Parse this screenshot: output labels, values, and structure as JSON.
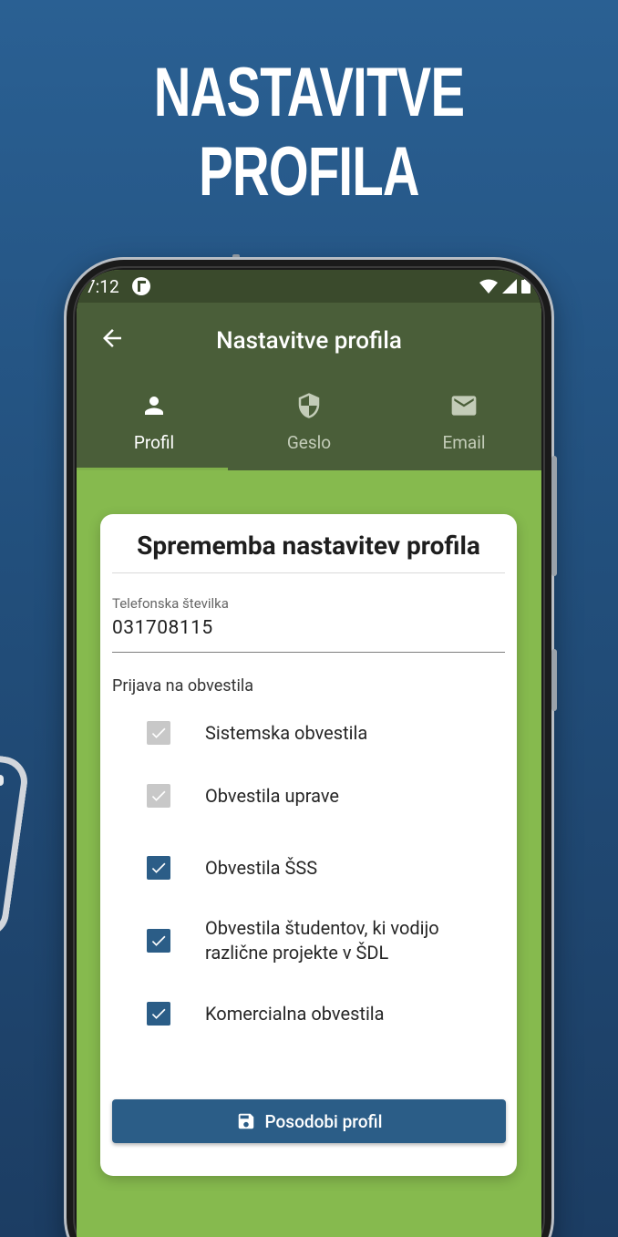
{
  "headline": "NASTAVITVE PROFILA",
  "status": {
    "time": "7:12"
  },
  "appbar": {
    "title": "Nastavitve profila"
  },
  "tabs": [
    {
      "label": "Profil",
      "icon": "person-icon",
      "active": true
    },
    {
      "label": "Geslo",
      "icon": "shield-icon",
      "active": false
    },
    {
      "label": "Email",
      "icon": "mail-icon",
      "active": false
    }
  ],
  "card": {
    "title": "Sprememba nastavitev profila",
    "phone_label": "Telefonska številka",
    "phone_value": "031708115",
    "subscriptions_label": "Prijava na obvestila",
    "checkboxes": [
      {
        "label": "Sistemska obvestila",
        "checked": true,
        "disabled": true
      },
      {
        "label": "Obvestila uprave",
        "checked": true,
        "disabled": true
      },
      {
        "label": "Obvestila ŠSS",
        "checked": true,
        "disabled": false
      },
      {
        "label": "Obvestila  študentov, ki vodijo različne projekte v ŠDL",
        "checked": true,
        "disabled": false
      },
      {
        "label": "Komercialna obvestila",
        "checked": true,
        "disabled": false
      }
    ],
    "save_label": "Posodobi profil"
  },
  "colors": {
    "appbar": "#4a5e39",
    "background": "#86ba4e",
    "accent": "#2b5d87"
  }
}
